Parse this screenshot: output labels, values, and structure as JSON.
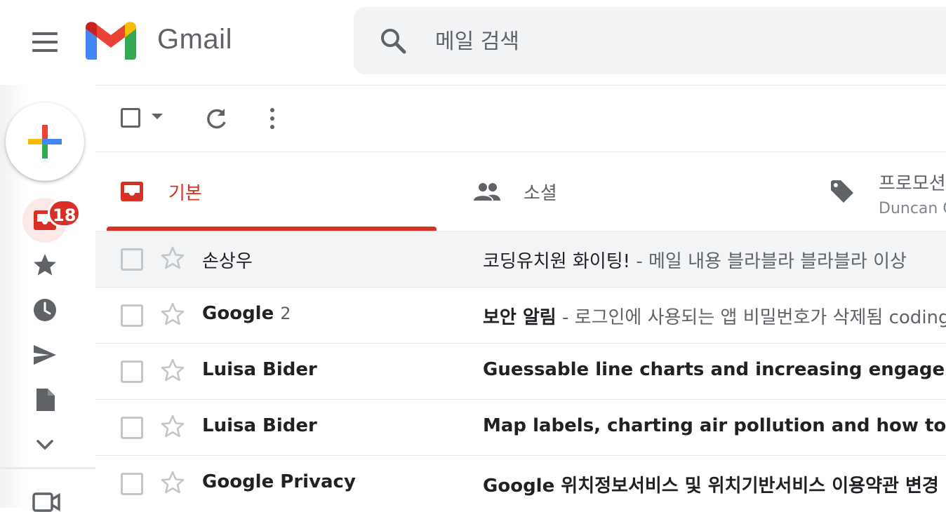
{
  "app": {
    "name": "Gmail"
  },
  "search": {
    "placeholder": "메일 검색"
  },
  "rail": {
    "inbox_badge": "18"
  },
  "tabs": [
    {
      "label": "기본",
      "active": true
    },
    {
      "label": "소셜"
    },
    {
      "label": "프로모션",
      "subtitle": "Duncan C"
    }
  ],
  "emails": [
    {
      "sender": "손상우",
      "count": "",
      "subject": "코딩유치원 화이팅!",
      "snippet": " - 메일 내용 블라블라 블라블라 이상",
      "unread": false
    },
    {
      "sender": "Google",
      "count": "2",
      "subject": "보안 알림",
      "snippet": " - 로그인에 사용되는 앱 비밀번호가 삭제됨 coding",
      "unread": true
    },
    {
      "sender": "Luisa Bider",
      "count": "",
      "subject": "Guessable line charts and increasing engagement t",
      "snippet": "",
      "unread": true
    },
    {
      "sender": "Luisa Bider",
      "count": "",
      "subject": "Map labels, charting air pollution and how to visual",
      "snippet": "",
      "unread": true
    },
    {
      "sender": "Google Privacy",
      "count": "",
      "subject": "Google 위치정보서비스 및 위치기반서비스 이용약관 변경 안",
      "snippet": "",
      "unread": true
    }
  ],
  "colors": {
    "accent_red": "#d93025",
    "gray_icon": "#5f6368",
    "search_bg": "#f1f3f4",
    "read_row_bg": "#f2f4f5"
  },
  "icons": {
    "menu": "hamburger-icon",
    "search": "search-icon",
    "compose": "plus-icon",
    "inbox": "inbox-icon",
    "starred": "star-icon",
    "snoozed": "clock-icon",
    "sent": "send-icon",
    "drafts": "file-icon",
    "more": "chevron-down-icon",
    "meet": "video-icon"
  }
}
